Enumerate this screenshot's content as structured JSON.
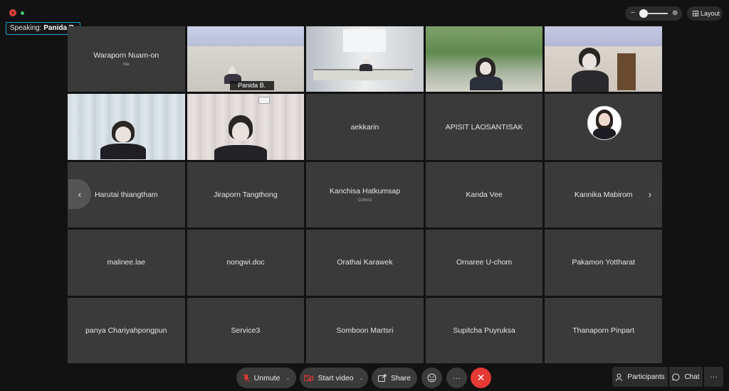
{
  "header": {
    "speaking_prefix": "Speaking: ",
    "speaking_name": "Panida B.",
    "zoom_out_icon": "−",
    "zoom_in_icon": "⊕",
    "layout_label": "Layout"
  },
  "tiles": [
    {
      "name": "Waraporn Nuam-on",
      "sub": "Me"
    },
    {
      "name": "Panida B."
    },
    {
      "name": ""
    },
    {
      "name": ""
    },
    {
      "name": ""
    },
    {
      "name": ""
    },
    {
      "name": ""
    },
    {
      "name": "aekkarin"
    },
    {
      "name": "APISIT LAOSANTISAK"
    },
    {
      "name": ""
    },
    {
      "name": "Harutai thiangtham"
    },
    {
      "name": "Jiraporn Tangthong"
    },
    {
      "name": "Kanchisa Hatkumsap",
      "sub": "Cohost"
    },
    {
      "name": "Kanda Vee"
    },
    {
      "name": "Kannika Mabirom"
    },
    {
      "name": "malinee.lae"
    },
    {
      "name": "nongwi.doc"
    },
    {
      "name": "Orathai Karawek"
    },
    {
      "name": "Ornaree U-chom"
    },
    {
      "name": "Pakamon Yottharat"
    },
    {
      "name": "panya Chariyahpongpun"
    },
    {
      "name": "Service3"
    },
    {
      "name": "Somboon Martsri"
    },
    {
      "name": "Supitcha Puyruksa"
    },
    {
      "name": "Thanaporn Pinpart"
    }
  ],
  "nav": {
    "prev_icon": "‹",
    "next_icon": "›"
  },
  "controls": {
    "unmute": "Unmute",
    "start_video": "Start video",
    "share": "Share",
    "more": "···",
    "leave": "✕",
    "caret": "⌄"
  },
  "panel": {
    "participants": "Participants",
    "chat": "Chat",
    "more": "···"
  },
  "colors": {
    "accent": "#1ea0d6",
    "leave": "#e53935",
    "background": "#121212",
    "tile": "#3a3a3a"
  }
}
